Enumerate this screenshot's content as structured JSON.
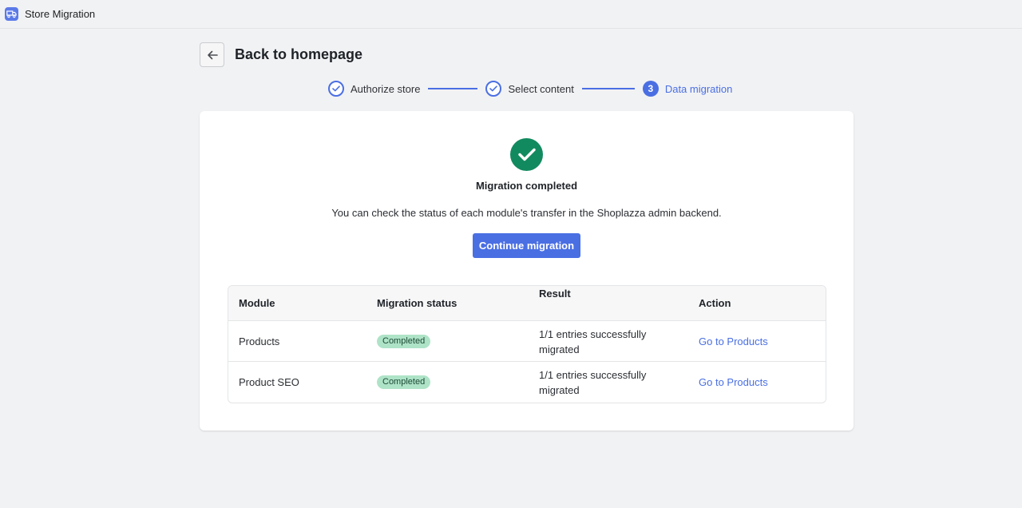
{
  "app": {
    "title": "Store Migration",
    "logo_icon": "truck-icon"
  },
  "header": {
    "back_icon": "arrow-left-icon",
    "title": "Back to homepage"
  },
  "stepper": {
    "steps": [
      {
        "label": "Authorize store",
        "state": "done"
      },
      {
        "label": "Select content",
        "state": "done"
      },
      {
        "label": "Data migration",
        "state": "current",
        "number": "3"
      }
    ],
    "accent": "#4a6fe3"
  },
  "card": {
    "status_icon": "check-circle-icon",
    "heading": "Migration completed",
    "description": "You can check the status of each module's transfer in the Shoplazza admin backend.",
    "continue_label": "Continue migration"
  },
  "table": {
    "headers": [
      "Module",
      "Migration status",
      "Result",
      "Action"
    ],
    "rows": [
      {
        "module": "Products",
        "status": "Completed",
        "result": "1/1 entries successfully migrated",
        "action": "Go to Products"
      },
      {
        "module": "Product SEO",
        "status": "Completed",
        "result": "1/1 entries successfully migrated",
        "action": "Go to Products"
      }
    ]
  },
  "colors": {
    "success": "#128a5f",
    "badge_bg": "#aee3c7",
    "page_bg": "#f1f2f4"
  }
}
